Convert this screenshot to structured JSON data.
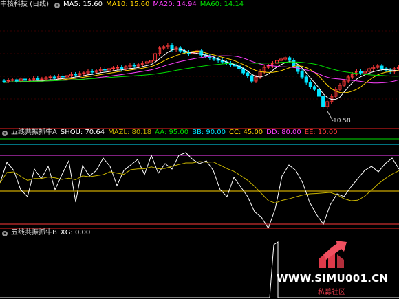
{
  "panel_main": {
    "title": "中核科技 (日线)",
    "ma5_label": "MA5: 15.60",
    "ma10_label": "MA10: 15.60",
    "ma20_label": "MA20: 14.94",
    "ma60_label": "MA60: 14.14",
    "low_marker": "10.58",
    "colors": {
      "ma5": "#ffffff",
      "ma10": "#ffd200",
      "ma20": "#ff40ff",
      "ma60": "#00e000",
      "up": "#ff3a3a",
      "down": "#00e5ff"
    }
  },
  "panel_a": {
    "title": "五线共振抓牛A",
    "shou": "SHOU: 70.64",
    "mazl": "MAZL: 80.18",
    "aa": "AA: 95.00",
    "bb": "BB: 90.00",
    "cc": "CC: 45.00",
    "dd": "DD: 80.00",
    "ee": "EE: 10.00",
    "colors": {
      "shou": "#ffffff",
      "mazl": "#c8b400",
      "aa": "#00e000",
      "bb": "#00e5ff",
      "cc": "#ffd200",
      "dd": "#ff40ff",
      "ee": "#ff3a3a"
    }
  },
  "panel_b": {
    "title": "五线共振抓牛B",
    "xg": "XG: 0.00"
  },
  "watermark": {
    "url": "WWW.SIMU001.CN",
    "sub": "私募社区"
  }
}
